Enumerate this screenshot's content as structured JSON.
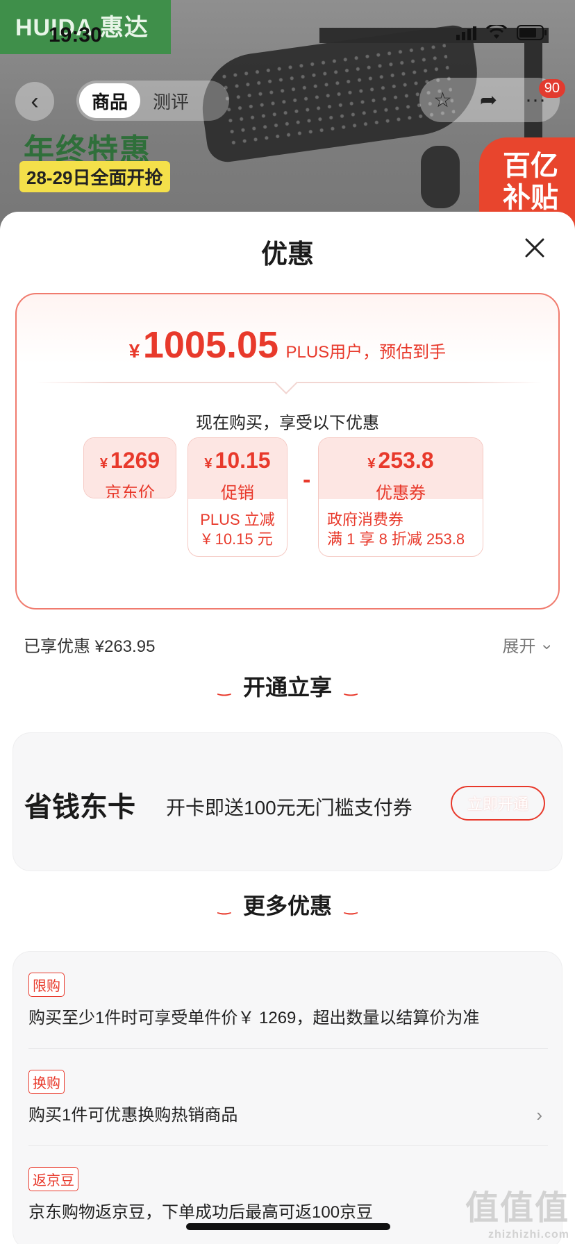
{
  "status_bar": {
    "time": "19:30"
  },
  "background": {
    "brand_text": "HUIDA 惠达",
    "promo_title": "年终特惠",
    "promo_sub": "28-29日全面开抢",
    "subsidy_badge": "百亿补贴"
  },
  "nav": {
    "back_icon": "chevron-left-icon",
    "tabs": [
      "商品",
      "测评"
    ],
    "active_tab": "商品",
    "cart_count": "90"
  },
  "sheet": {
    "title": "优惠",
    "close_icon": "close-icon"
  },
  "price_card": {
    "currency": "¥",
    "estimated_price": "1005.05",
    "estimated_note": "PLUS用户，预估到手",
    "buy_now_text": "现在购买，享受以下优惠",
    "breakdown": [
      {
        "currency": "¥",
        "value": "1269",
        "label": "京东价"
      },
      {
        "currency": "¥",
        "value": "10.15",
        "label": "促销",
        "detail_line1": "PLUS 立减",
        "detail_line2": "¥ 10.15 元"
      },
      {
        "currency": "¥",
        "value": "253.8",
        "label": "优惠券",
        "detail_line1": "政府消费券",
        "detail_line2": "满 1 享 8 折减 253.8"
      }
    ],
    "operators": [
      "-",
      "-"
    ]
  },
  "summary": {
    "enjoyed": "已享优惠 ¥263.95",
    "expand": "展开"
  },
  "membership_section": {
    "heading": "开通立享",
    "name": "省钱东卡",
    "desc": "开卡即送100元无门槛支付券",
    "button": "立即开通"
  },
  "more_section": {
    "heading": "更多优惠",
    "offers": [
      {
        "tag": "限购",
        "text": "购买至少1件时可享受单件价￥ 1269，超出数量以结算价为准"
      },
      {
        "tag": "换购",
        "text": "购买1件可优惠换购热销商品"
      },
      {
        "tag": "返京豆",
        "text": "京东购物返京豆，下单成功后最高可返100京豆"
      }
    ]
  },
  "watermark": {
    "main": "值值值",
    "sub": "zhizhizhi.com"
  },
  "colors": {
    "accent": "#e8392b",
    "card_border": "#f07b6e",
    "chip_bg": "#fde6e3"
  }
}
